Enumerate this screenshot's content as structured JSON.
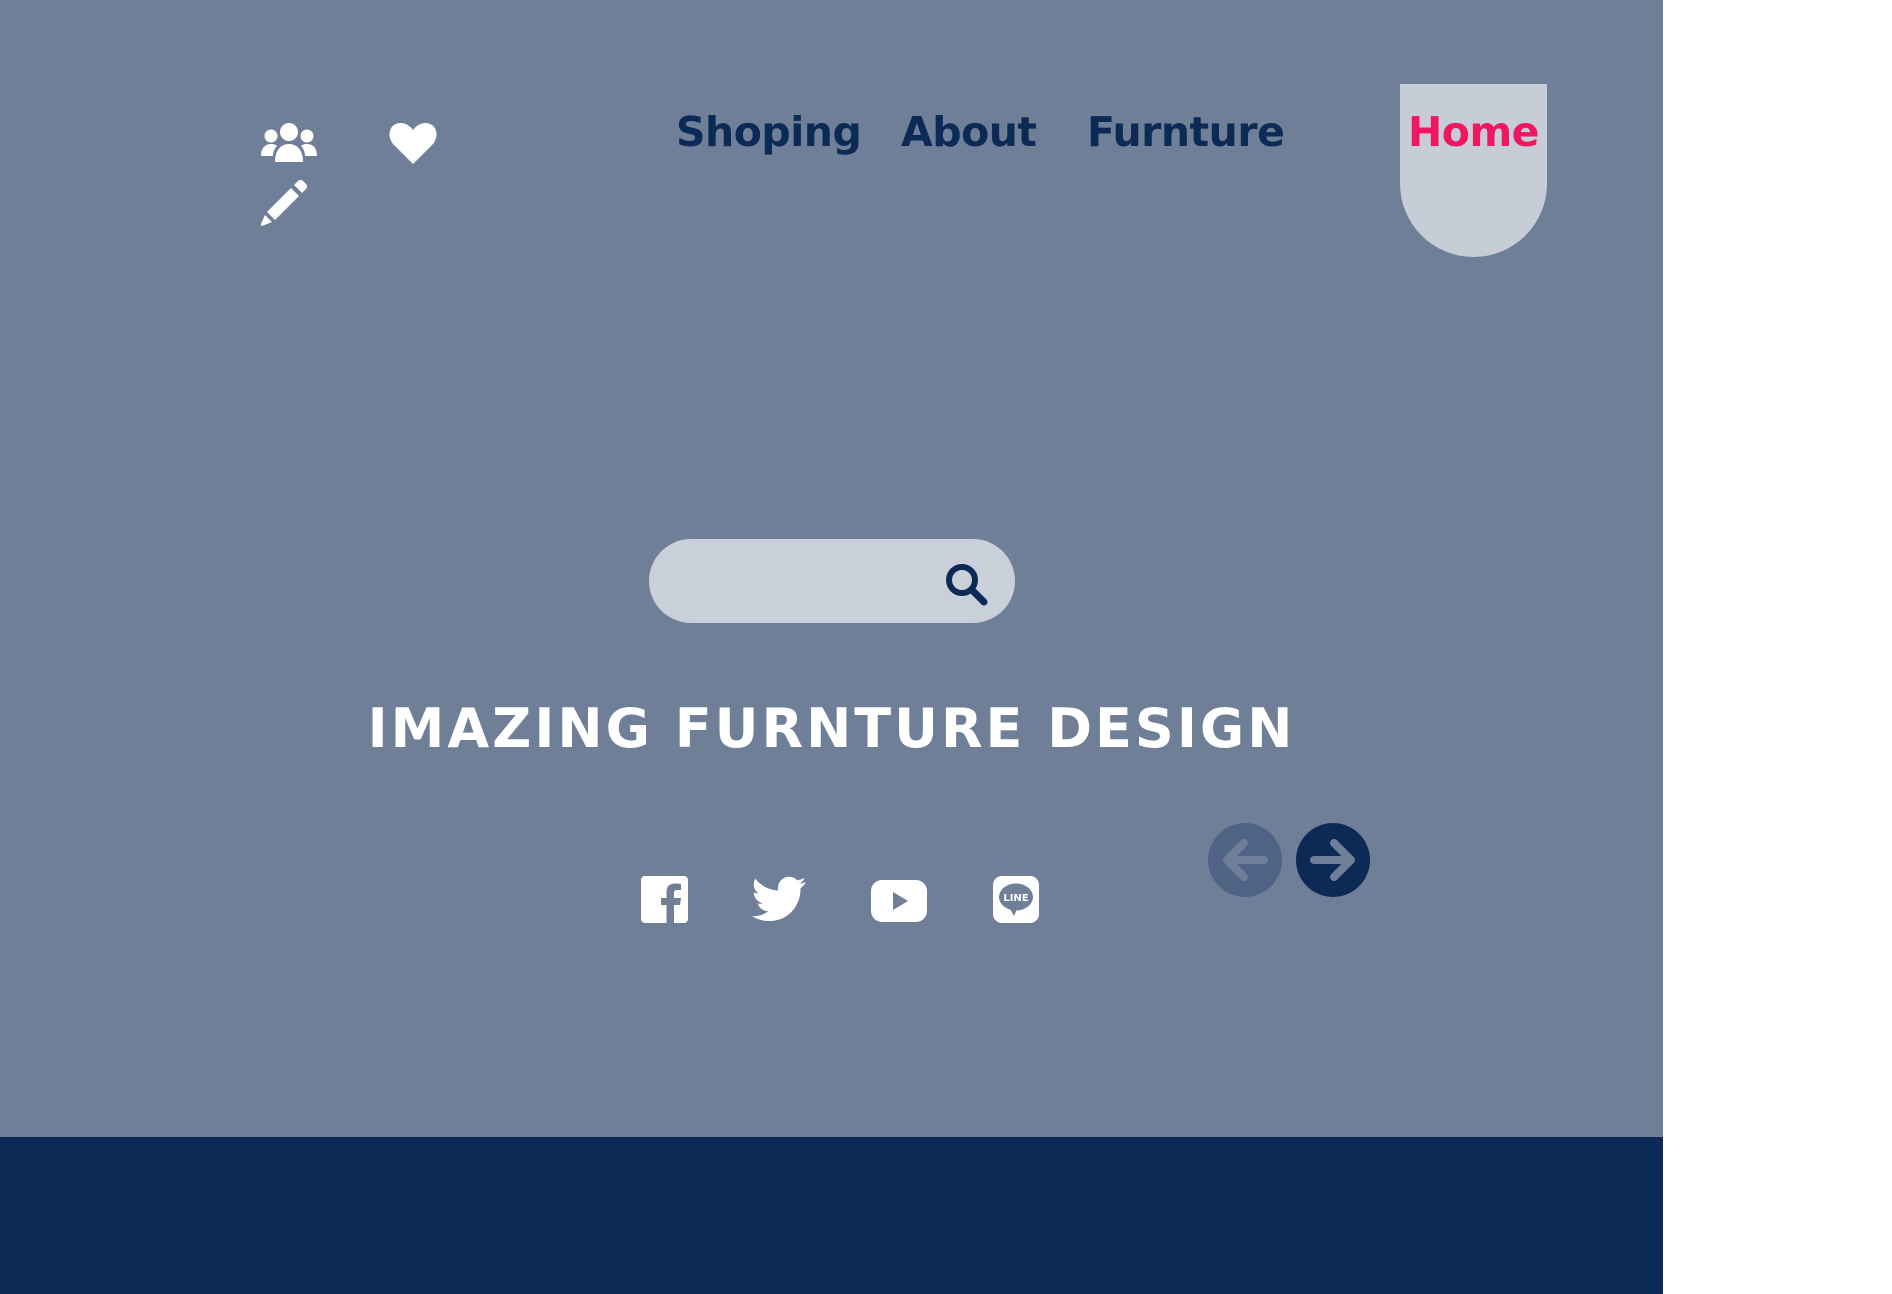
{
  "nav": {
    "items": [
      {
        "label": "Shoping"
      },
      {
        "label": "About"
      },
      {
        "label": "Furnture"
      },
      {
        "label": "Home",
        "active": true
      }
    ]
  },
  "utility_icons": [
    "users-icon",
    "heart-icon",
    "pencil-icon"
  ],
  "search": {
    "value": "",
    "placeholder": "",
    "icon": "search-icon"
  },
  "hero": {
    "headline": "IMAZING FURNTURE DESIGN"
  },
  "carousel": {
    "prev_icon": "arrow-left-icon",
    "next_icon": "arrow-right-icon"
  },
  "social": [
    "facebook-icon",
    "twitter-icon",
    "youtube-icon",
    "line-icon"
  ],
  "colors": {
    "hero_bg": "#6e7f97",
    "footer_bg": "#0b2a55",
    "nav_text": "#0b2a55",
    "active_nav_text": "#ee1760",
    "active_nav_bg": "#c7cdd6",
    "search_bg": "#c9d0d9",
    "headline_text": "#ffffff",
    "prev_button_bg": "#4f6485",
    "next_button_bg": "#0b2a55"
  }
}
